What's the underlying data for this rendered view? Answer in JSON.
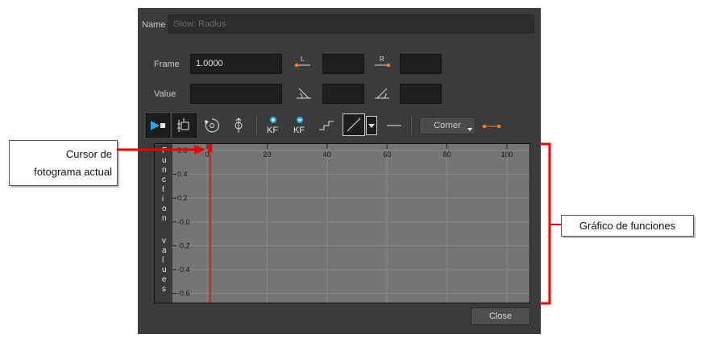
{
  "dialog": {
    "name_label": "Name",
    "name_value": "Glow: Radius",
    "frame_label": "Frame",
    "frame_value": "1.0000",
    "value_label": "Value",
    "value_value": "",
    "left_handle_label": "L",
    "right_handle_label": "R",
    "kf_add_label": "KF",
    "kf_remove_label": "KF",
    "corner_label": "Corner",
    "close_label": "Close"
  },
  "graph": {
    "x_ticks": [
      "0",
      "20",
      "40",
      "60",
      "80",
      "100"
    ],
    "y_ticks": [
      "0.6",
      "0.4",
      "0.2",
      "-0.0",
      "-0.2",
      "-0.4",
      "-0.6"
    ],
    "y_axis_title": "Function values",
    "current_frame": 1,
    "accent": "#e00000"
  },
  "annotations": {
    "cursor_line1": "Cursor de",
    "cursor_line2": "fotograma actual",
    "graph_label": "Gráfico de funciones",
    "color": "#ee0000"
  },
  "colors": {
    "dialog_bg": "#3b3b3b",
    "graph_bg": "#757575",
    "icon_accent": "#f07a2a",
    "kf_accent": "#27b4e0"
  }
}
